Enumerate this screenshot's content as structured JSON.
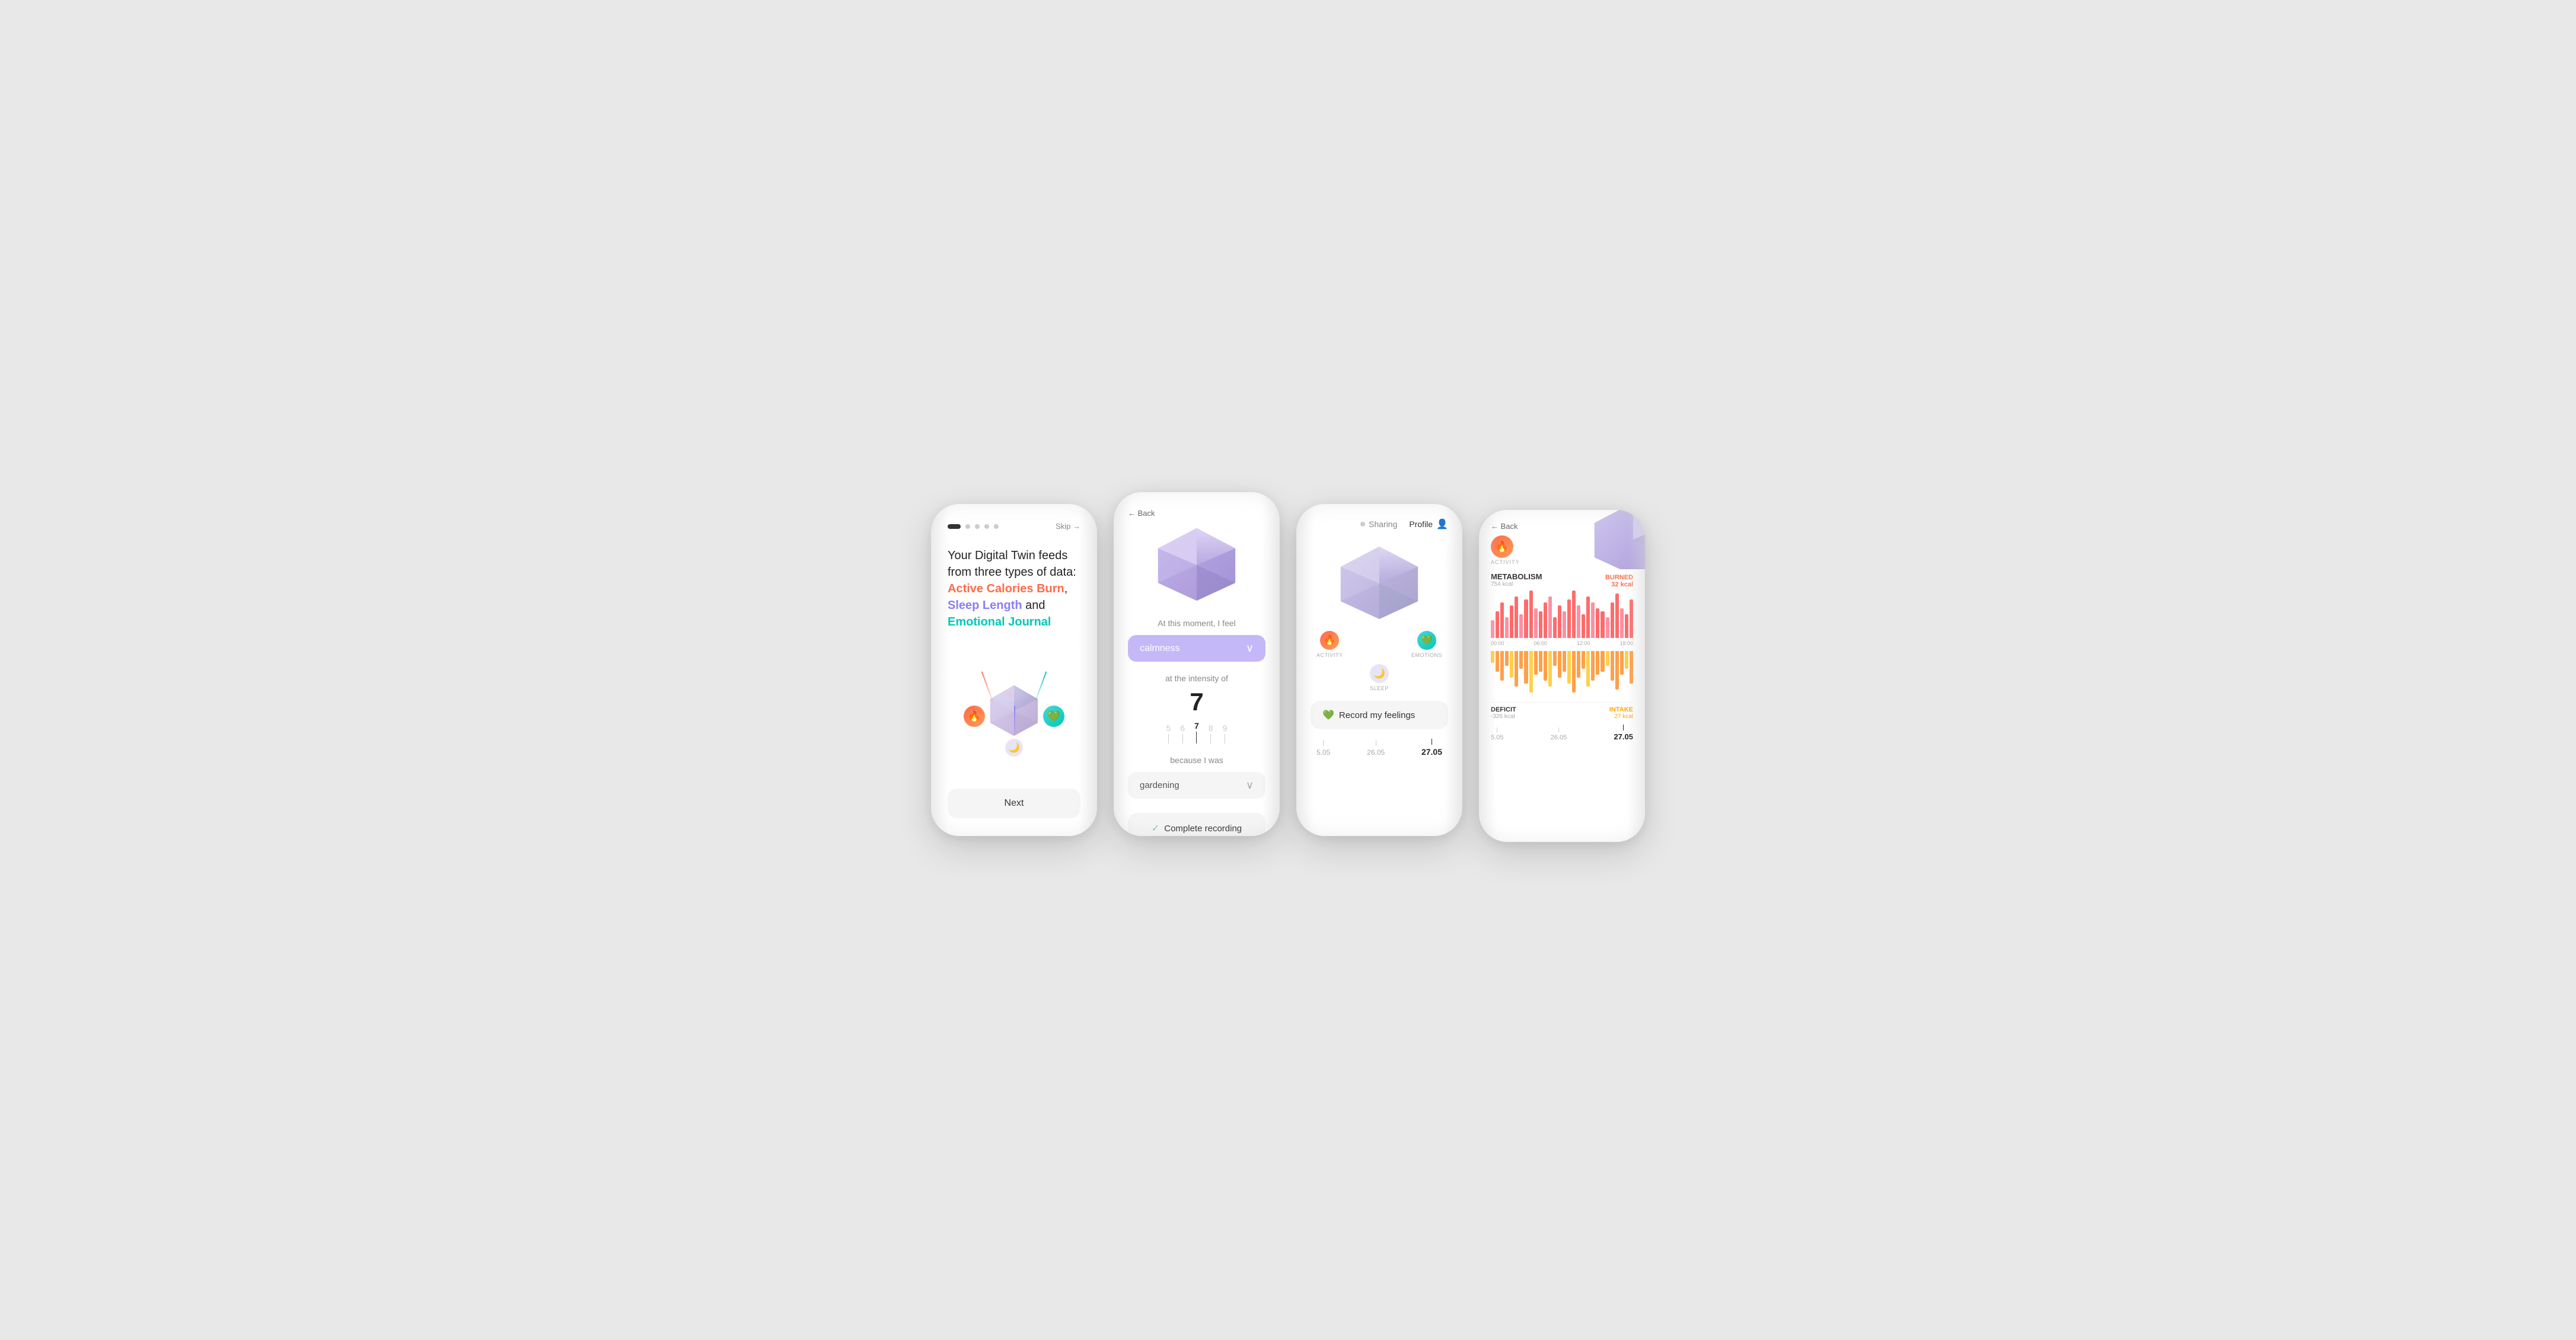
{
  "phones": {
    "phone1": {
      "dots": [
        "active",
        "inactive",
        "inactive",
        "inactive",
        "inactive"
      ],
      "skip_label": "Skip →",
      "title_plain": "Your Digital Twin feeds\nfrom three types of data:",
      "title_orange": "Active Calories Burn",
      "title_connector1": ",",
      "title_purple": "Sleep Length",
      "title_connector2": " and",
      "title_teal": "Emotional Journal",
      "next_label": "Next"
    },
    "phone2": {
      "back_label": "← Back",
      "at_this_moment": "At this moment, I feel",
      "feeling": "calmness",
      "at_intensity": "at the intensity of",
      "intensity_value": "7",
      "scale_numbers": [
        "5",
        "6",
        "7",
        "8",
        "9"
      ],
      "because_label": "because I was",
      "reason": "gardening",
      "complete_label": "Complete recording"
    },
    "phone3": {
      "tab_sharing": "Sharing",
      "tab_profile": "Profile",
      "icon_activity_label": "ACTIVITY",
      "icon_emotions_label": "EMOTIONS",
      "icon_sleep_label": "SLEEP",
      "record_label": "Record my feelings",
      "timeline": [
        "5.05",
        "26.05",
        "27.05"
      ],
      "timeline_active": "27.05"
    },
    "phone4": {
      "back_label": "← Back",
      "activity_label": "ACTIVITY",
      "metabolism_label": "METABOLISM",
      "burned_label": "BURNED",
      "burned_value": "32 kcal",
      "metabolism_value": "754 kcal",
      "time_labels": [
        "00:00",
        "06:00",
        "12:00",
        "18:00"
      ],
      "deficit_label": "DEFICIT",
      "deficit_value": "-326 kcal",
      "intake_label": "INTAKE",
      "intake_value": "27 kcal",
      "timeline": [
        "5.05",
        "26.05",
        "27.05"
      ],
      "timeline_active": "27.05",
      "bar_heights_top": [
        30,
        45,
        60,
        35,
        55,
        70,
        40,
        65,
        80,
        50,
        45,
        60,
        70,
        35,
        55,
        45,
        65,
        80,
        55,
        40,
        70,
        60,
        50,
        45,
        35,
        60,
        75,
        50,
        40,
        65
      ],
      "bar_heights_bottom": [
        20,
        35,
        50,
        25,
        45,
        60,
        30,
        55,
        70,
        40,
        35,
        50,
        60,
        25,
        45,
        35,
        55,
        70,
        45,
        30,
        60,
        50,
        40,
        35,
        25,
        50,
        65,
        40,
        30,
        55
      ]
    }
  }
}
